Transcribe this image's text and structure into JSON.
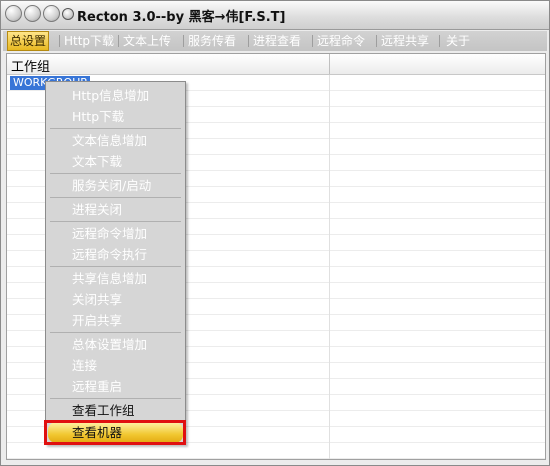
{
  "window": {
    "title": "Recton 3.0--by 黑客→伟[F.S.T]"
  },
  "menu": {
    "items": [
      {
        "label": "总设置",
        "active": true
      },
      {
        "label": "Http下载"
      },
      {
        "label": "文本上传"
      },
      {
        "label": "服务传看"
      },
      {
        "label": "进程查看"
      },
      {
        "label": "远程命令"
      },
      {
        "label": "远程共享"
      },
      {
        "label": "关于"
      }
    ]
  },
  "list": {
    "column_header": "工作组",
    "rows": [
      "WORKGROUP"
    ]
  },
  "context_menu": {
    "items": [
      {
        "label": "Http信息增加"
      },
      {
        "label": "Http下载"
      },
      {
        "label": "文本信息增加"
      },
      {
        "label": "文本下载"
      },
      {
        "label": "服务关闭/启动"
      },
      {
        "label": "进程关闭"
      },
      {
        "label": "远程命令增加"
      },
      {
        "label": "远程命令执行"
      },
      {
        "label": "共享信息增加"
      },
      {
        "label": "关闭共享"
      },
      {
        "label": "开启共享"
      },
      {
        "label": "总体设置增加"
      },
      {
        "label": "连接"
      },
      {
        "label": "远程重启"
      },
      {
        "label": "查看工作组",
        "enabled": true
      },
      {
        "label": "查看机器",
        "highlighted": true
      }
    ]
  },
  "colors": {
    "highlight_outline": "#e01010",
    "selection": "#3875d7",
    "active_menu": "#f1c730"
  }
}
